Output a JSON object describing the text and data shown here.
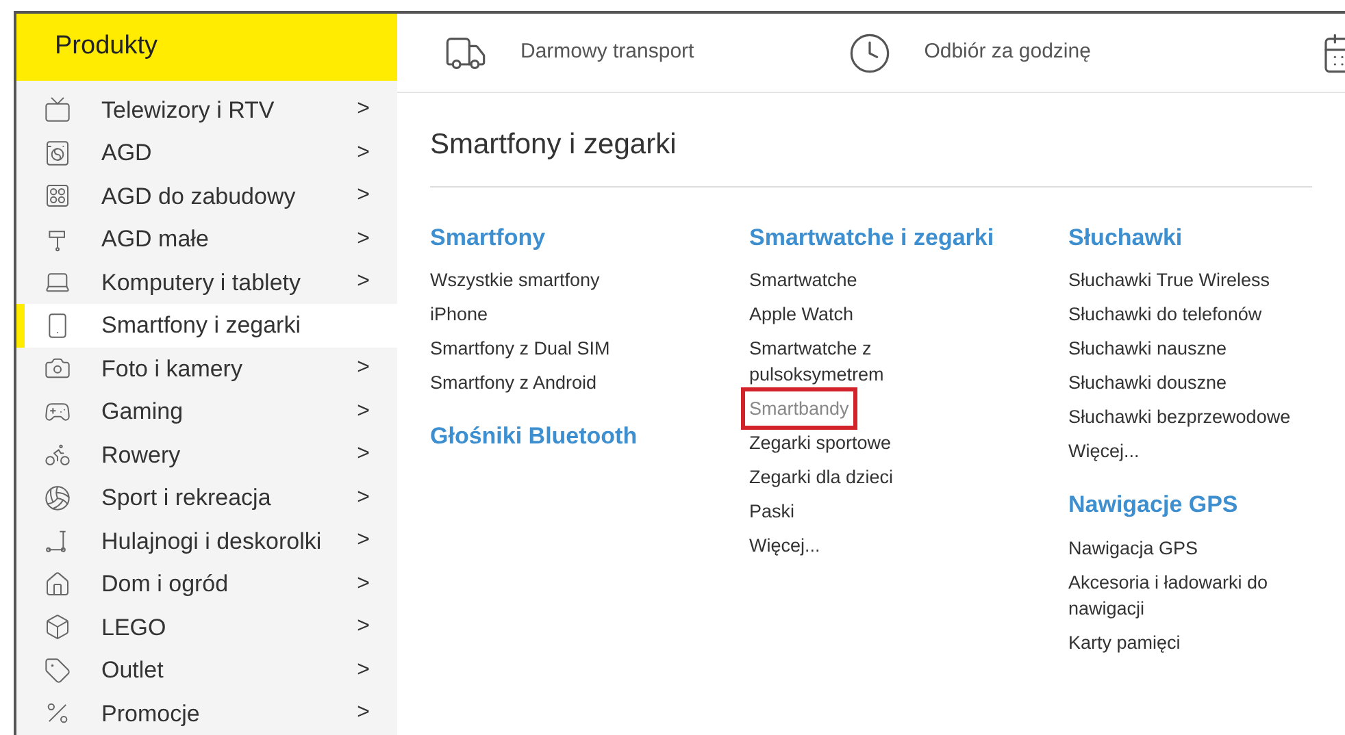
{
  "sidebar": {
    "title": "Produkty",
    "items": [
      {
        "label": "Telewizory i RTV",
        "selected": false,
        "chevron": ">"
      },
      {
        "label": "AGD",
        "selected": false,
        "chevron": ">"
      },
      {
        "label": "AGD do zabudowy",
        "selected": false,
        "chevron": ">"
      },
      {
        "label": "AGD małe",
        "selected": false,
        "chevron": ">"
      },
      {
        "label": "Komputery i tablety",
        "selected": false,
        "chevron": ">"
      },
      {
        "label": "Smartfony i zegarki",
        "selected": true
      },
      {
        "label": "Foto i kamery",
        "selected": false,
        "chevron": ">"
      },
      {
        "label": "Gaming",
        "selected": false,
        "chevron": ">"
      },
      {
        "label": "Rowery",
        "selected": false,
        "chevron": ">"
      },
      {
        "label": "Sport i rekreacja",
        "selected": false,
        "chevron": ">"
      },
      {
        "label": "Hulajnogi i deskorolki",
        "selected": false,
        "chevron": ">"
      },
      {
        "label": "Dom i ogród",
        "selected": false,
        "chevron": ">"
      },
      {
        "label": "LEGO",
        "selected": false,
        "chevron": ">"
      },
      {
        "label": "Outlet",
        "selected": false,
        "chevron": ">"
      },
      {
        "label": "Promocje",
        "selected": false,
        "chevron": ">"
      }
    ]
  },
  "top_bar": {
    "features": [
      {
        "label": "Darmowy transport"
      },
      {
        "label": "Odbiór za godzinę"
      }
    ]
  },
  "content": {
    "title": "Smartfony i zegarki",
    "columns": [
      {
        "sections": [
          {
            "title": "Smartfony",
            "links": [
              {
                "label": "Wszystkie smartfony",
                "highlighted": false
              },
              {
                "label": "iPhone",
                "highlighted": false
              },
              {
                "label": "Smartfony z Dual SIM",
                "highlighted": false
              },
              {
                "label": "Smartfony z Android",
                "highlighted": false
              }
            ]
          },
          {
            "title": "Głośniki Bluetooth"
          }
        ]
      },
      {
        "sections": [
          {
            "title": "Smartwatche i zegarki",
            "links": [
              {
                "label": "Smartwatche",
                "highlighted": false
              },
              {
                "label": "Apple Watch",
                "highlighted": false
              },
              {
                "label": "Smartwatche z pulsoksymetrem",
                "highlighted": false
              },
              {
                "label": "Smartbandy",
                "highlighted": true
              },
              {
                "label": "Zegarki sportowe",
                "highlighted": false
              },
              {
                "label": "Zegarki dla dzieci",
                "highlighted": false
              },
              {
                "label": "Paski",
                "highlighted": false
              },
              {
                "label": "Więcej...",
                "highlighted": false
              }
            ]
          }
        ]
      },
      {
        "sections": [
          {
            "title": "Słuchawki",
            "links": [
              {
                "label": "Słuchawki True Wireless",
                "highlighted": false
              },
              {
                "label": "Słuchawki do telefonów",
                "highlighted": false
              },
              {
                "label": "Słuchawki nauszne",
                "highlighted": false
              },
              {
                "label": "Słuchawki douszne",
                "highlighted": false
              },
              {
                "label": "Słuchawki bezprzewodowe",
                "highlighted": false
              },
              {
                "label": "Więcej...",
                "highlighted": false
              }
            ]
          },
          {
            "title": "Nawigacje GPS",
            "links": [
              {
                "label": "Nawigacja GPS",
                "highlighted": false
              },
              {
                "label": "Akcesoria i ładowarki do nawigacji",
                "highlighted": false
              },
              {
                "label": "Karty pamięci",
                "highlighted": false
              }
            ]
          }
        ]
      }
    ]
  }
}
